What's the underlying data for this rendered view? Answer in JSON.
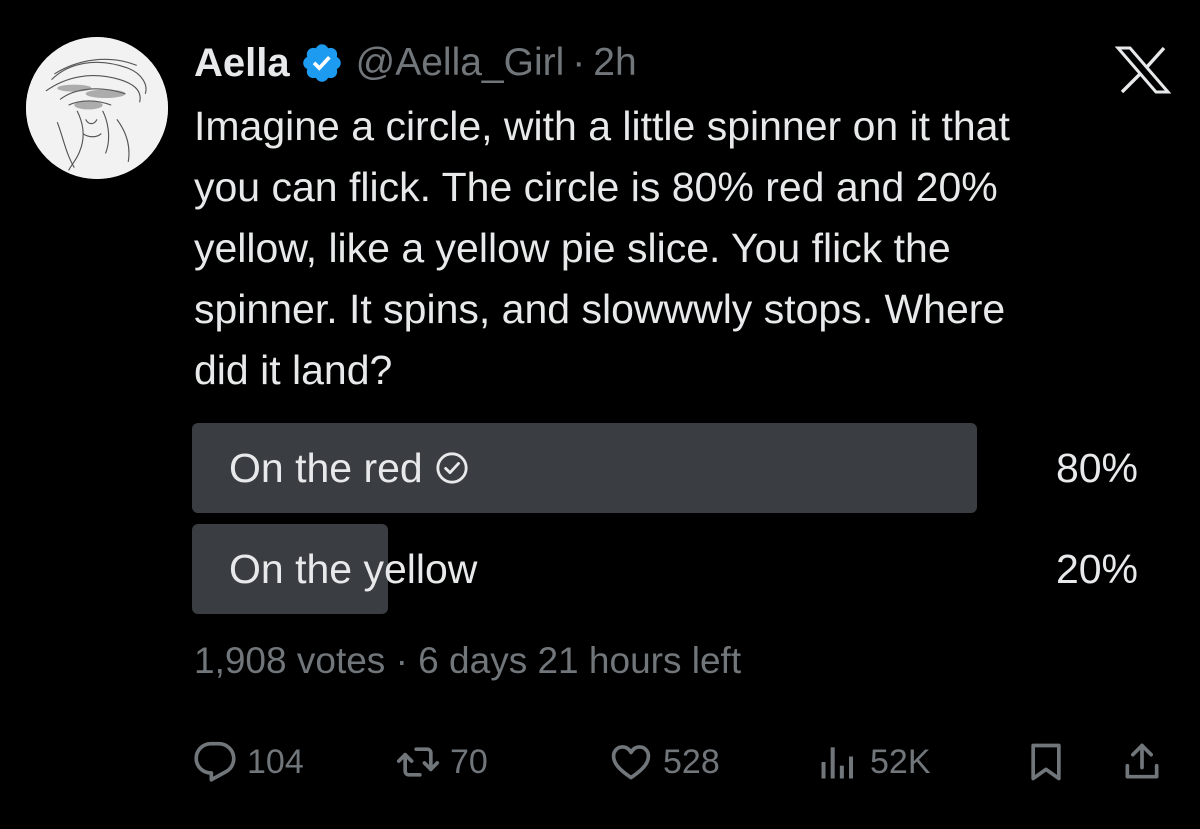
{
  "author": {
    "name": "Aella",
    "handle": "@Aella_Girl",
    "separator": "·",
    "time": "2h",
    "verified_color": "#1d9bf0"
  },
  "tweet": {
    "text": "Imagine a circle, with a little spinner on it that\nyou can flick. The circle is 80% red and 20%\nyellow, like a yellow pie slice. You flick the\nspinner. It spins, and slowwwly stops.  Where\ndid it land?"
  },
  "poll": {
    "options": [
      {
        "label": "On the red",
        "percent_label": "80%",
        "share": 0.8,
        "selected": true
      },
      {
        "label": "On the yellow",
        "percent_label": "20%",
        "share": 0.2,
        "selected": false
      }
    ],
    "meta": "1,908 votes · 6 days 21 hours left",
    "bar_color": "#3a3d41"
  },
  "actions": {
    "reply_count": "104",
    "retweet_count": "70",
    "like_count": "528",
    "views_count": "52K",
    "icons": [
      "reply-icon",
      "retweet-icon",
      "like-icon",
      "views-icon",
      "bookmark-icon",
      "share-icon"
    ]
  },
  "colors": {
    "background": "#000000",
    "text": "#e7e9ea",
    "secondary_text": "#71767b"
  }
}
